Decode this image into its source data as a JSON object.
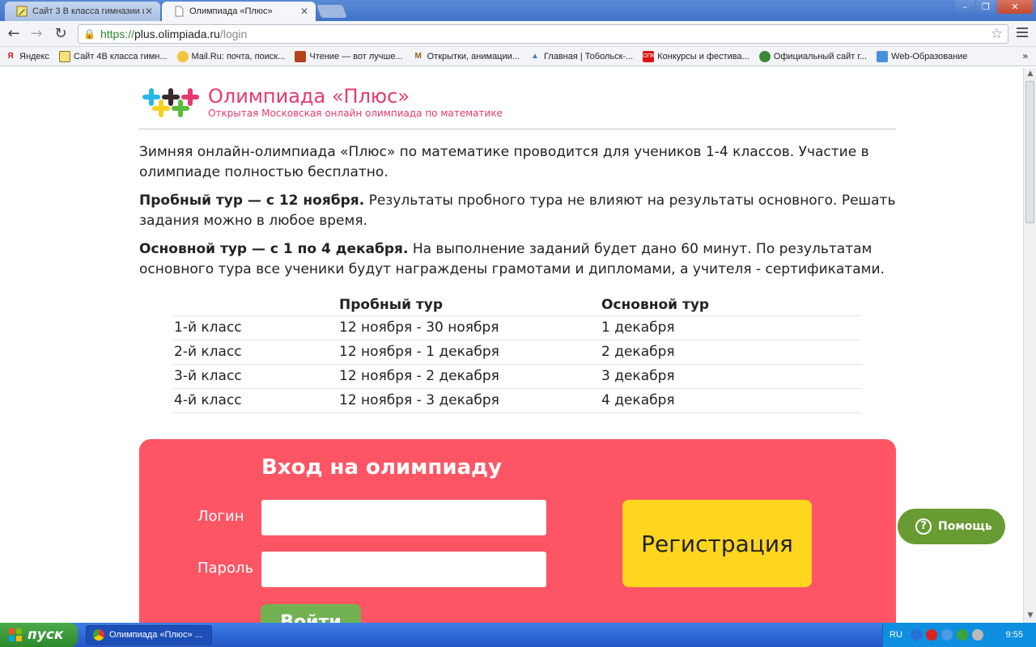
{
  "browser": {
    "tabs": [
      {
        "title": "Сайт 3 В класса гимназии и"
      },
      {
        "title": "Олимпиада «Плюс»"
      }
    ],
    "url": {
      "scheme": "https://",
      "host": "plus.olimpiada.ru",
      "path": "/login"
    },
    "bookmarks": [
      "Яндекс",
      "Сайт 4В класса гимн...",
      "Mail.Ru: почта, поиск...",
      "Чтение — вот лучше...",
      "Открытки, анимации...",
      "Главная | Тобольск-...",
      "Конкурсы и фестива...",
      "Официальный сайт г...",
      "Web-Образование"
    ],
    "more_bookmarks": "»"
  },
  "header": {
    "title": "Олимпиада «Плюс»",
    "subtitle": "Открытая Московская онлайн олимпиада по математике"
  },
  "intro": {
    "p1": "Зимняя онлайн-олимпиада «Плюс» по математике проводится для учеников 1-4 классов. Участие в олимпиаде полностью бесплатно.",
    "p2_bold": "Пробный тур — с 12 ноября.",
    "p2_text": " Результаты пробного тура не влияют на результаты основного. Решать задания можно в любое время.",
    "p3_bold": "Основной тур — с 1 по 4 декабря.",
    "p3_text": " На выполнение заданий будет дано 60 минут. По результатам основного тура все ученики будут награждены грамотами и дипломами, а учителя - сертификатами."
  },
  "schedule": {
    "headers": [
      "",
      "Пробный тур",
      "Основной тур"
    ],
    "rows": [
      [
        "1-й класс",
        "12 ноября - 30 ноября",
        "1 декабря"
      ],
      [
        "2-й класс",
        "12 ноября - 1 декабря",
        "2 декабря"
      ],
      [
        "3-й класс",
        "12 ноября - 2 декабря",
        "3 декабря"
      ],
      [
        "4-й класс",
        "12 ноября - 3 декабря",
        "4 декабря"
      ]
    ]
  },
  "login": {
    "title": "Вход на олимпиаду",
    "login_label": "Логин",
    "password_label": "Пароль",
    "login_value": "",
    "password_value": "",
    "register_label": "Регистрация",
    "enter_label": "Войти"
  },
  "help": {
    "label": "Помощь"
  },
  "taskbar": {
    "start_label": "пуск",
    "task_label": "Олимпиада «Плюс» ...",
    "lang": "RU",
    "clock": "9:55"
  },
  "colors": {
    "brand": "#e8386d",
    "login_panel": "#fe5565",
    "register": "#ffd520",
    "enter": "#73b253",
    "help": "#689b32"
  }
}
